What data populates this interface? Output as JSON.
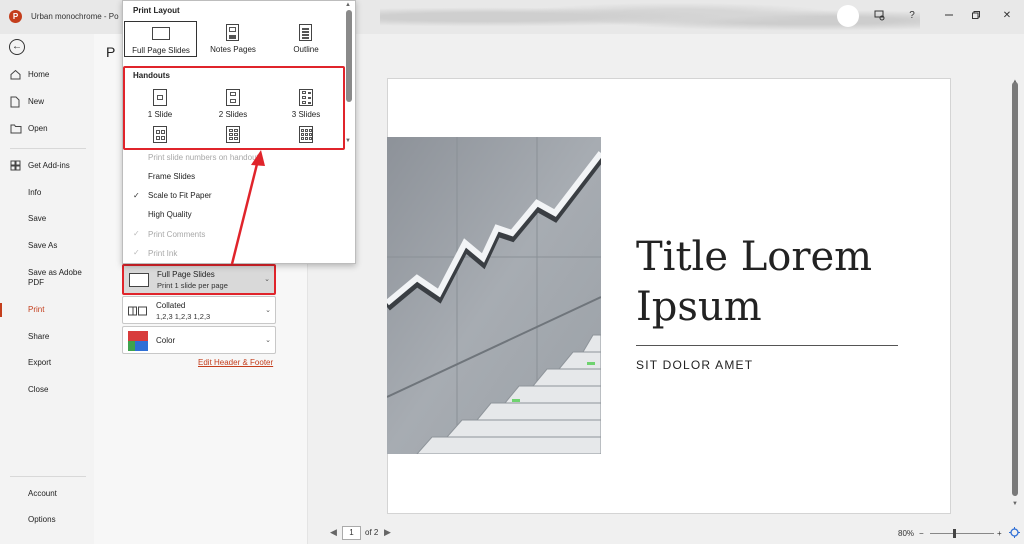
{
  "titlebar": {
    "app_logo": "P",
    "doc_title": "Urban monochrome  -  Po",
    "icons": [
      "profile-circle",
      "coauthor-icon",
      "help-icon",
      "restore-icon",
      "close-icon"
    ],
    "help": "?",
    "close": "✕"
  },
  "nav": {
    "items": [
      {
        "label": "Home",
        "icon": "home-icon"
      },
      {
        "label": "New",
        "icon": "new-icon"
      },
      {
        "label": "Open",
        "icon": "open-icon"
      },
      {
        "label": "Get Add-ins",
        "icon": "addins-icon"
      },
      {
        "label": "Info"
      },
      {
        "label": "Save"
      },
      {
        "label": "Save As"
      },
      {
        "label": "Save as Adobe",
        "label2": "PDF"
      },
      {
        "label": "Print",
        "active": true
      },
      {
        "label": "Share"
      },
      {
        "label": "Export"
      },
      {
        "label": "Close"
      },
      {
        "label": "Account"
      },
      {
        "label": "Options"
      }
    ]
  },
  "settings": {
    "heading_stub": "P",
    "slides_setting": {
      "line1": "Full Page Slides",
      "line2": "Print 1 slide per page"
    },
    "collate_setting": {
      "line1": "Collated",
      "line2": "1,2,3    1,2,3    1,2,3"
    },
    "color_setting": {
      "line1": "Color"
    },
    "edit_link": "Edit Header & Footer"
  },
  "popup": {
    "print_layout_heading": "Print Layout",
    "layouts": [
      "Full Page Slides",
      "Notes Pages",
      "Outline"
    ],
    "handouts_heading": "Handouts",
    "handouts": [
      "1 Slide",
      "2 Slides",
      "3 Slides"
    ],
    "options": [
      {
        "label": "Print slide numbers on handout",
        "checked": false,
        "dim": true
      },
      {
        "label": "Frame Slides",
        "checked": false,
        "dim": false
      },
      {
        "label": "Scale to Fit Paper",
        "checked": true,
        "dim": false
      },
      {
        "label": "High Quality",
        "checked": false,
        "dim": false
      },
      {
        "label": "Print Comments",
        "checked": true,
        "dim": true
      },
      {
        "label": "Print Ink",
        "checked": true,
        "dim": true
      }
    ]
  },
  "preview": {
    "slide_title": "Title Lorem Ipsum",
    "slide_subtitle": "SIT DOLOR AMET",
    "page_current": "1",
    "page_total_label": "of 2",
    "zoom_label": "80%",
    "zoom_minus": "−",
    "zoom_plus": "+"
  },
  "colors": {
    "accent": "#c43e1c",
    "highlight": "#e0242b"
  }
}
